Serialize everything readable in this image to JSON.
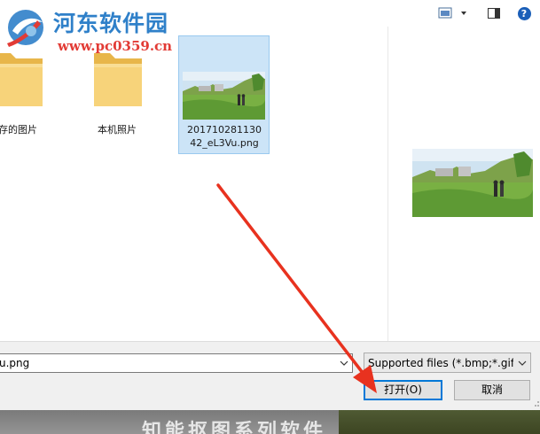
{
  "watermark": {
    "title": "河东软件园",
    "url": "www.pc0359.cn"
  },
  "toolbar": {
    "view_mode_icon": "view-mode-icon",
    "preview_pane_icon": "preview-pane-icon",
    "help_icon": "help-icon",
    "help_glyph": "?"
  },
  "files": [
    {
      "label": "存的图片",
      "type": "folder",
      "icon": "folder-icon"
    },
    {
      "label": "本机照片",
      "type": "folder",
      "icon": "folder-icon"
    },
    {
      "label": "20171028113042_eL3Vu.png",
      "type": "image",
      "selected": true
    }
  ],
  "filename_input": {
    "value": "u.png"
  },
  "filetype_select": {
    "selected": "Supported files (*.bmp;*.gif;*"
  },
  "buttons": {
    "open_label": "打开(O)",
    "cancel_label": "取消"
  },
  "background_page": {
    "text": "知能抠图系列软件"
  },
  "colors": {
    "selection_fill": "#cce4f7",
    "selection_border": "#99c9ef",
    "open_button_border": "#0078d7",
    "annotation_arrow": "#e8321f"
  }
}
